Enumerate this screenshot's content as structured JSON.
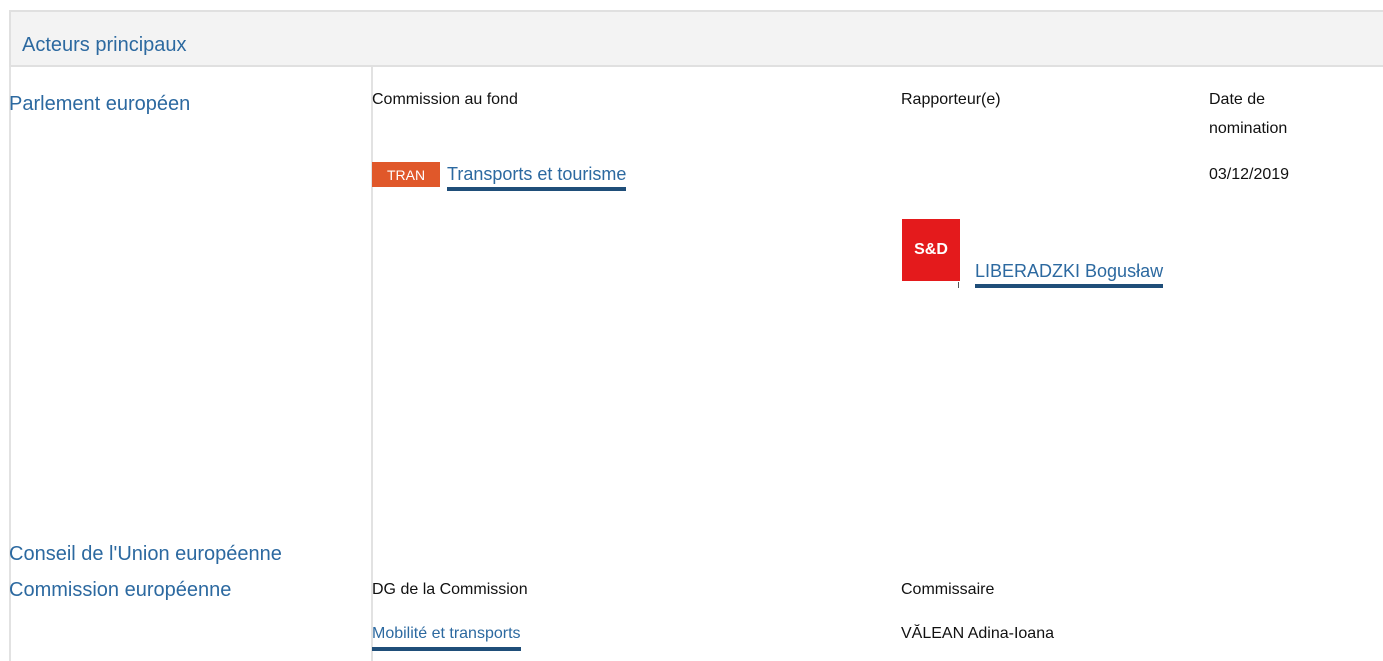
{
  "header": {
    "title": "Acteurs principaux"
  },
  "parliament": {
    "institution": "Parlement européen",
    "col_committee": "Commission au fond",
    "col_rapporteur": "Rapporteur(e)",
    "col_date_line1": "Date de",
    "col_date_line2": "nomination",
    "committee_badge": "TRAN",
    "committee_name": "Transports et tourisme",
    "date": "03/12/2019",
    "group_logo": "S&D",
    "rapporteur_name": "LIBERADZKI Bogusław",
    "colors": {
      "badge": "#e0582a",
      "logo": "#e41a1c",
      "link": "#2c69a0"
    }
  },
  "council": {
    "institution": "Conseil de l'Union européenne"
  },
  "commission": {
    "institution": "Commission européenne",
    "col_dg": "DG de la Commission",
    "col_commissioner": "Commissaire",
    "dg_name": "Mobilité et transports",
    "commissioner_name": "VĂLEAN Adina-Ioana"
  }
}
